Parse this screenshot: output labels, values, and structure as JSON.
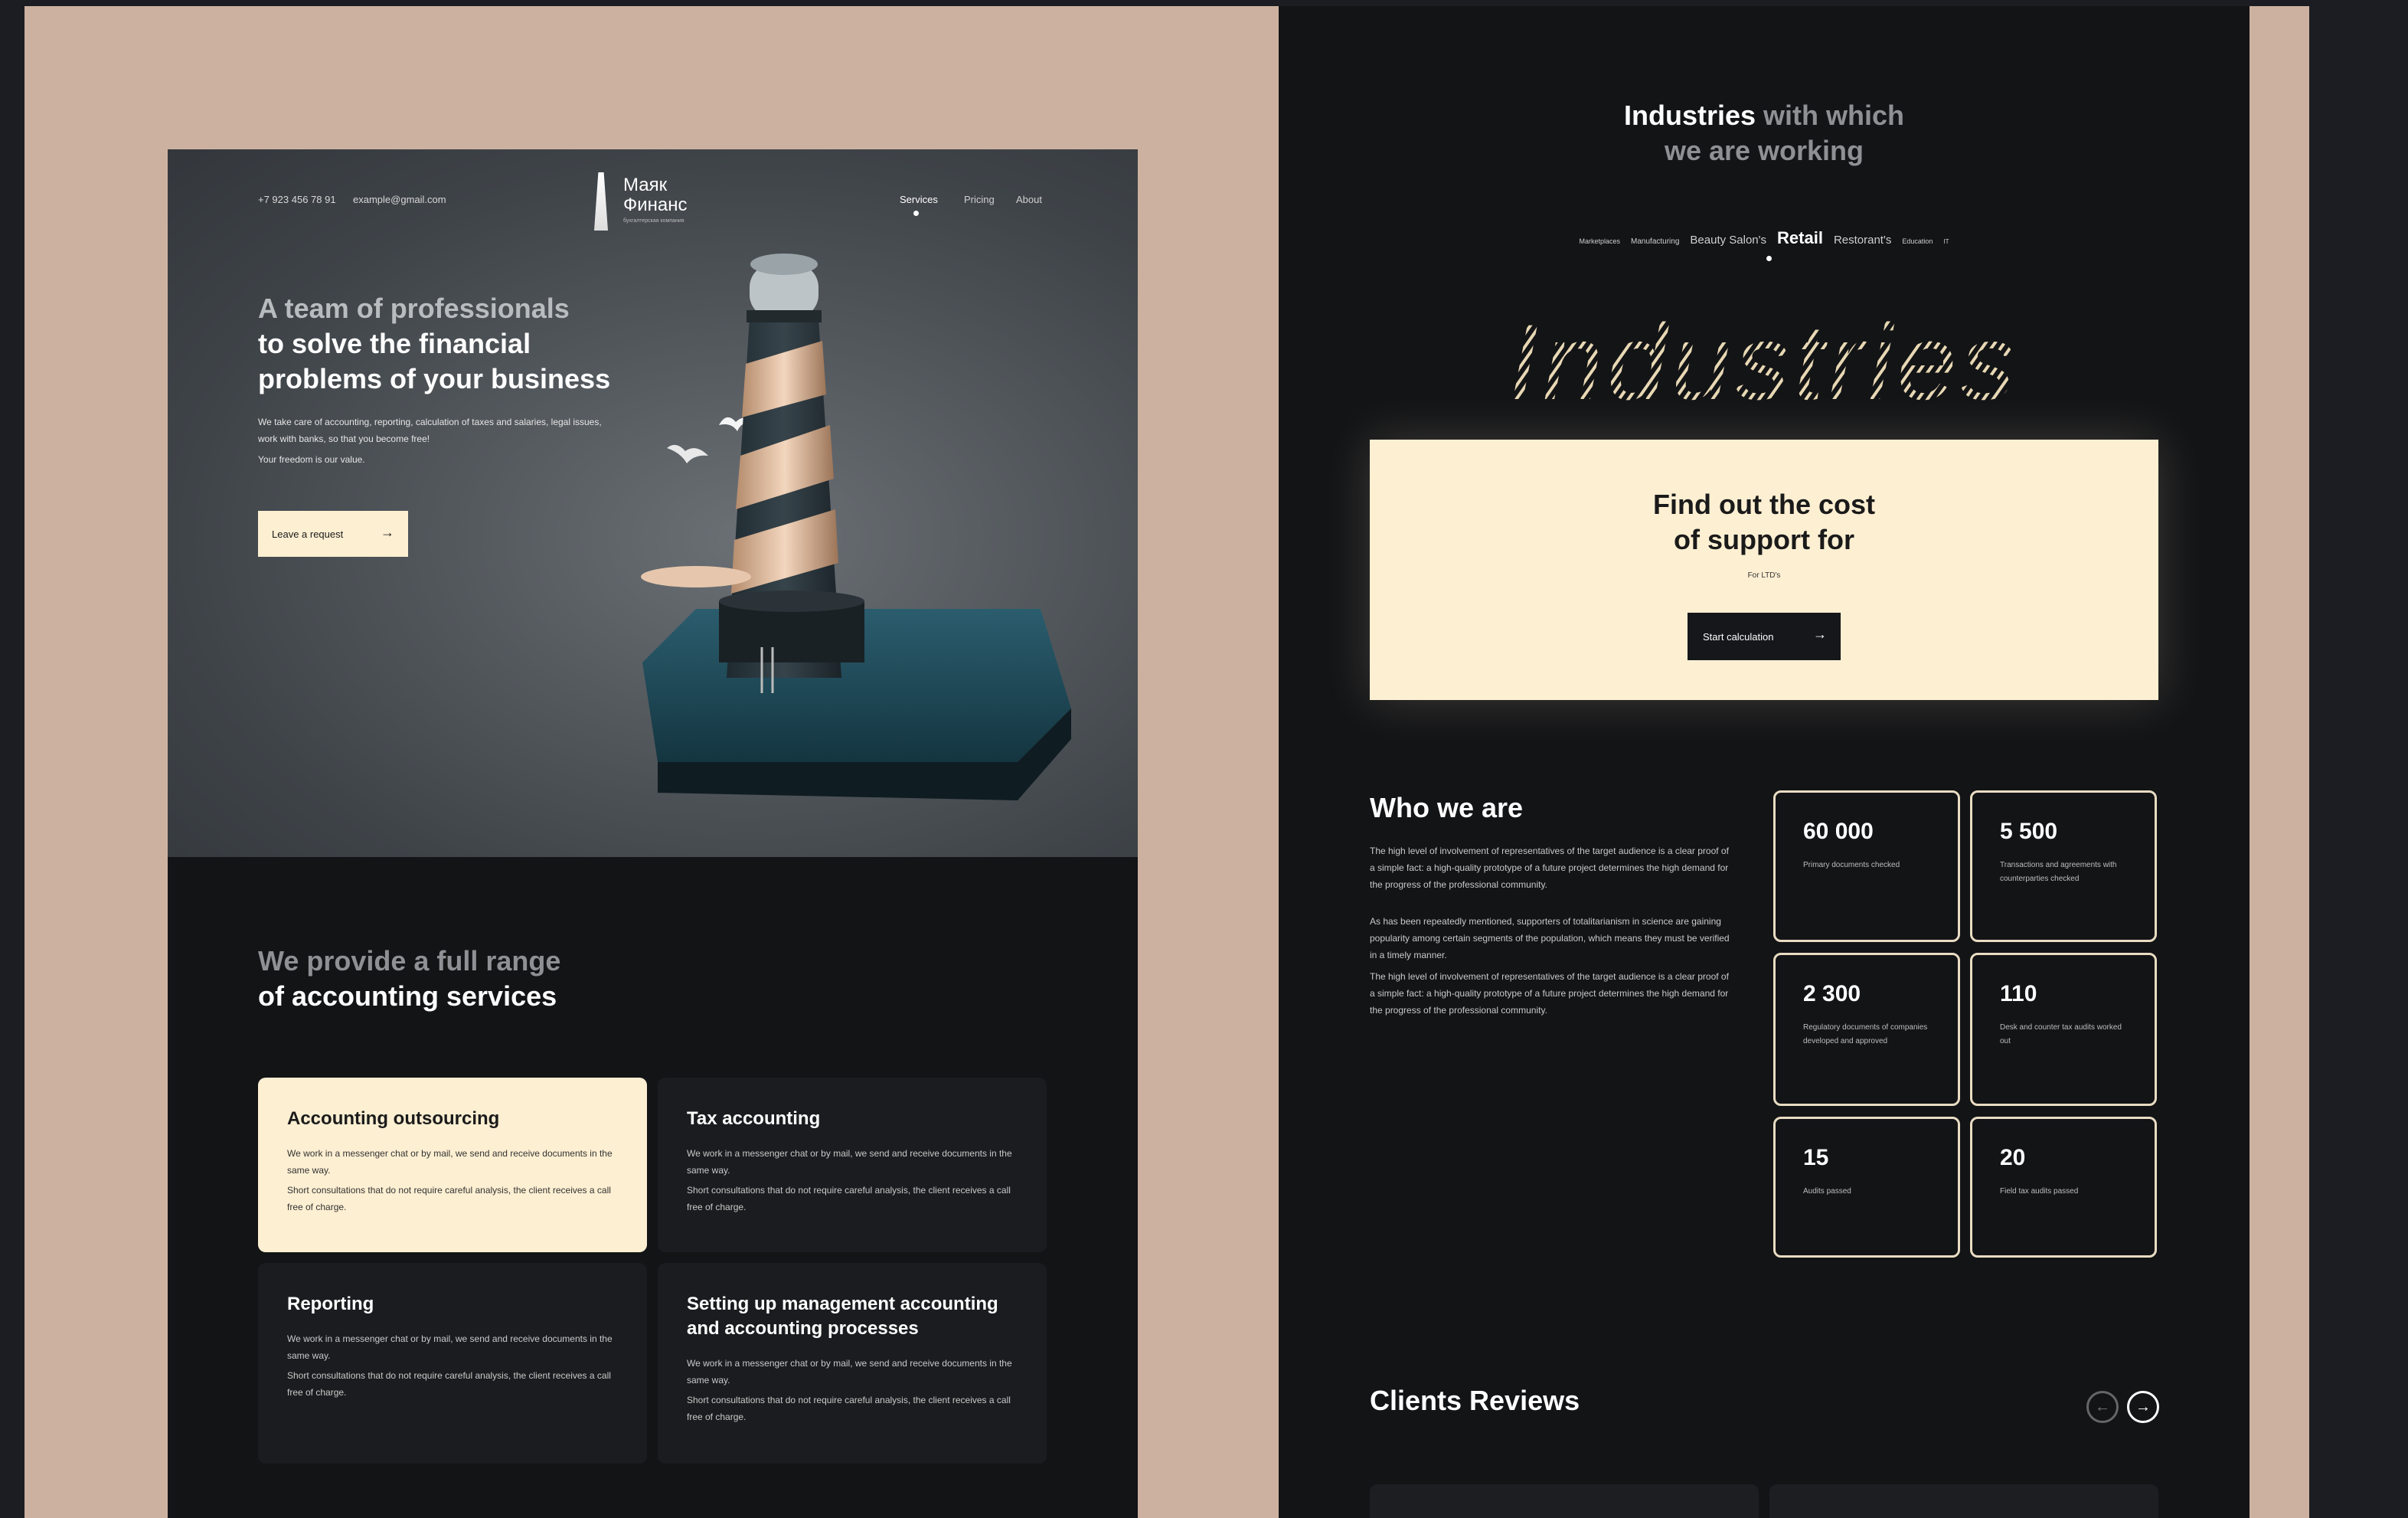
{
  "left": {
    "header": {
      "phone": "+7 923 456 78 91",
      "email": "example@gmail.com",
      "logo_name_line1": "Маяк",
      "logo_name_line2": "Финанс",
      "logo_tagline": "бухгалтерская компания",
      "nav": [
        "Services",
        "Pricing",
        "About"
      ],
      "active_nav": "Services"
    },
    "hero": {
      "title_dim": "A team of professionals",
      "title_line2": "to solve the financial",
      "title_line3": "problems of your business",
      "paragraph": "We take care of accounting, reporting, calculation of taxes and salaries, legal issues, work with banks, so that you become free!",
      "paragraph2": "Your freedom is our value.",
      "cta_label": "Leave a request",
      "cta_arrow": "→"
    },
    "services": {
      "heading_dim": "We provide a full range",
      "heading_bright": "of accounting services",
      "cards": [
        {
          "title": "Accounting outsourcing",
          "p1": "We work in a messenger chat or by mail, we send and receive documents in the same way.",
          "p2": "Short consultations that do not require careful analysis, the client receives a call free of charge."
        },
        {
          "title": "Tax accounting",
          "p1": "We work in a messenger chat or by mail, we send and receive documents in the same way.",
          "p2": "Short consultations that do not require careful analysis, the client receives a call free of charge."
        },
        {
          "title": "Reporting",
          "p1": "We work in a messenger chat or by mail, we send and receive documents in the same way.",
          "p2": "Short consultations that do not require careful analysis, the client receives a call free of charge."
        },
        {
          "title": "Setting up management accounting and accounting processes",
          "p1": "We work in a messenger chat or by mail, we send and receive documents in the same way.",
          "p2": "Short consultations that do not require careful analysis, the client receives a call free of charge."
        }
      ]
    }
  },
  "right": {
    "industries": {
      "title_bright": "Industries",
      "title_dim1": "with which",
      "title_dim2": "we are working",
      "tabs": [
        "Marketplaces",
        "Manufacturing",
        "Beauty Salon's",
        "Retail",
        "Restorant's",
        "Education",
        "IT"
      ],
      "active_tab": "Retail",
      "big_word": "Industries"
    },
    "cost": {
      "title_line1": "Find out the cost",
      "title_line2": "of support for",
      "subtitle": "For LTD's",
      "button_label": "Start calculation",
      "button_arrow": "→"
    },
    "who": {
      "title": "Who we are",
      "p1": "The high level of involvement of representatives of the target audience is a clear proof of a simple fact: a high-quality prototype of a future project determines the high demand for the progress of the professional community.",
      "p2": "As has been repeatedly mentioned, supporters of totalitarianism in science are gaining popularity among certain segments of the population, which means they must be verified in a timely manner.",
      "p3": "The high level of involvement of representatives of the target audience is a clear proof of a simple fact: a high-quality prototype of a future project determines the high demand for the progress of the professional community.",
      "stats": [
        {
          "num": "60 000",
          "label": "Primary documents checked"
        },
        {
          "num": "5 500",
          "label": "Transactions and agreements with counterparties checked"
        },
        {
          "num": "2 300",
          "label": "Regulatory documents of companies developed and approved"
        },
        {
          "num": "110",
          "label": "Desk and counter tax audits worked out"
        },
        {
          "num": "15",
          "label": "Audits passed"
        },
        {
          "num": "20",
          "label": "Field tax audits passed"
        }
      ]
    },
    "reviews": {
      "title": "Clients Reviews",
      "prev": "←",
      "next": "→"
    }
  },
  "colors": {
    "page_bg": "#1c1d22",
    "mockup_frame": "#cdb1a0",
    "cream": "#fdefd2",
    "dark": "#131416"
  },
  "icons": [
    "lighthouse-logo-icon",
    "arrow-right-icon",
    "arrow-left-icon"
  ]
}
